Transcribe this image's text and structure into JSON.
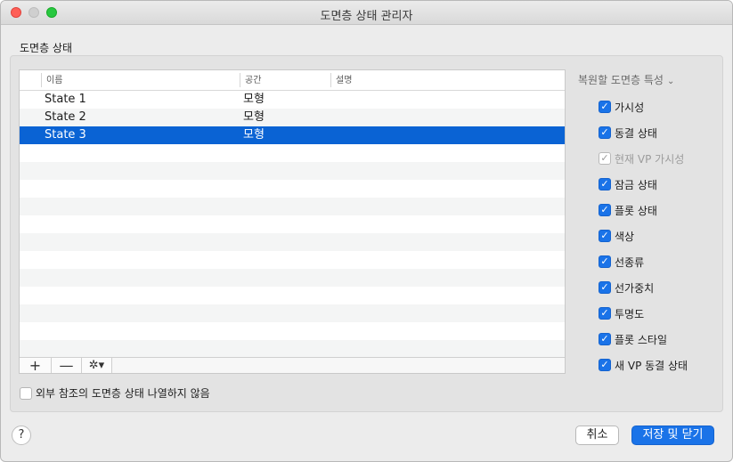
{
  "window": {
    "title": "도면층 상태 관리자"
  },
  "section_label": "도면층 상태",
  "table": {
    "columns": [
      "이름",
      "공간",
      "설명"
    ],
    "rows": [
      {
        "name": "State 1",
        "space": "모형",
        "desc": ""
      },
      {
        "name": "State 2",
        "space": "모형",
        "desc": ""
      },
      {
        "name": "State 3",
        "space": "모형",
        "desc": ""
      }
    ],
    "footer": {
      "add": "+",
      "remove": "—",
      "gear": "✲▾"
    }
  },
  "restore": {
    "header": "복원할 도면층 특성",
    "chevron": "⌄",
    "items": [
      {
        "label": "가시성",
        "checked": true,
        "enabled": true
      },
      {
        "label": "동결 상태",
        "checked": true,
        "enabled": true
      },
      {
        "label": "현재 VP 가시성",
        "checked": true,
        "enabled": false
      },
      {
        "label": "잠금 상태",
        "checked": true,
        "enabled": true
      },
      {
        "label": "플롯 상태",
        "checked": true,
        "enabled": true
      },
      {
        "label": "색상",
        "checked": true,
        "enabled": true
      },
      {
        "label": "선종류",
        "checked": true,
        "enabled": true
      },
      {
        "label": "선가중치",
        "checked": true,
        "enabled": true
      },
      {
        "label": "투명도",
        "checked": true,
        "enabled": true
      },
      {
        "label": "플롯 스타일",
        "checked": true,
        "enabled": true
      },
      {
        "label": "새 VP 동결 상태",
        "checked": true,
        "enabled": true
      }
    ]
  },
  "options": {
    "no_xref_label": "외부 참조의 도면층 상태 나열하지 않음"
  },
  "buttons": {
    "help": "?",
    "cancel": "취소",
    "save_close": "저장 및 닫기"
  }
}
